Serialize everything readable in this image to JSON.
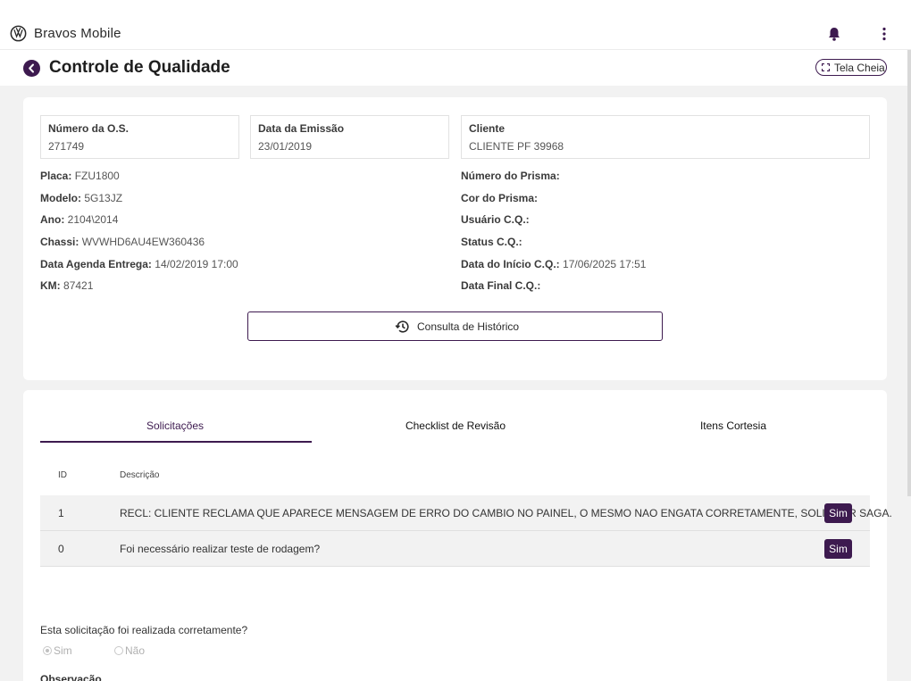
{
  "app": {
    "title": "Bravos Mobile",
    "logo_icon": "vw-logo-icon",
    "notification_icon": "bell-icon",
    "menu_icon": "kebab-menu-icon"
  },
  "header": {
    "back_icon": "chevron-left-icon",
    "page_title": "Controle de Qualidade",
    "fullscreen_label": "Tela Cheia",
    "fullscreen_icon": "fullscreen-icon"
  },
  "order": {
    "os_number_label": "Número da O.S.",
    "os_number_value": "271749",
    "emission_date_label": "Data da Emissão",
    "emission_date_value": "23/01/2019",
    "client_label": "Cliente",
    "client_value": "CLIENTE PF 39968"
  },
  "vehicle": {
    "placa_label": "Placa:",
    "placa_value": "FZU1800",
    "modelo_label": "Modelo:",
    "modelo_value": "5G13JZ",
    "ano_label": "Ano:",
    "ano_value": "2104\\2014",
    "chassi_label": "Chassi:",
    "chassi_value": "WVWHD6AU4EW360436",
    "agenda_label": "Data Agenda Entrega:",
    "agenda_value": "14/02/2019 17:00",
    "km_label": "KM:",
    "km_value": "87421"
  },
  "quality": {
    "prisma_number_label": "Número do Prisma:",
    "prisma_number_value": "",
    "prisma_color_label": "Cor do Prisma:",
    "prisma_color_value": "",
    "cq_user_label": "Usuário C.Q.:",
    "cq_user_value": "",
    "cq_status_label": "Status C.Q.:",
    "cq_status_value": "",
    "cq_start_label": "Data do Início C.Q.:",
    "cq_start_value": "17/06/2025 17:51",
    "cq_end_label": "Data Final C.Q.:",
    "cq_end_value": ""
  },
  "history_button": {
    "label": "Consulta de Histórico",
    "icon": "history-icon"
  },
  "tabs": [
    {
      "label": "Solicitações",
      "active": true
    },
    {
      "label": "Checklist de Revisão",
      "active": false
    },
    {
      "label": "Itens Cortesia",
      "active": false
    }
  ],
  "table": {
    "columns": [
      "ID",
      "Descrição"
    ],
    "rows": [
      {
        "id": "1",
        "description": "RECL: CLIENTE RECLAMA QUE APARECE MENSAGEM DE ERRO DO CAMBIO NO PAINEL, O MESMO NAO ENGATA CORRETAMENTE, SOLICITAR SAGA.",
        "status": "Sim"
      },
      {
        "id": "0",
        "description": "Foi necessário realizar teste de rodagem?",
        "status": "Sim"
      }
    ]
  },
  "form": {
    "question": "Esta solicitação foi realizada corretamente?",
    "option_yes": "Sim",
    "option_no": "Não",
    "selected": "Sim",
    "observation_label": "Observação"
  },
  "colors": {
    "accent": "#3d1a4f",
    "background": "#f2f2f2"
  }
}
